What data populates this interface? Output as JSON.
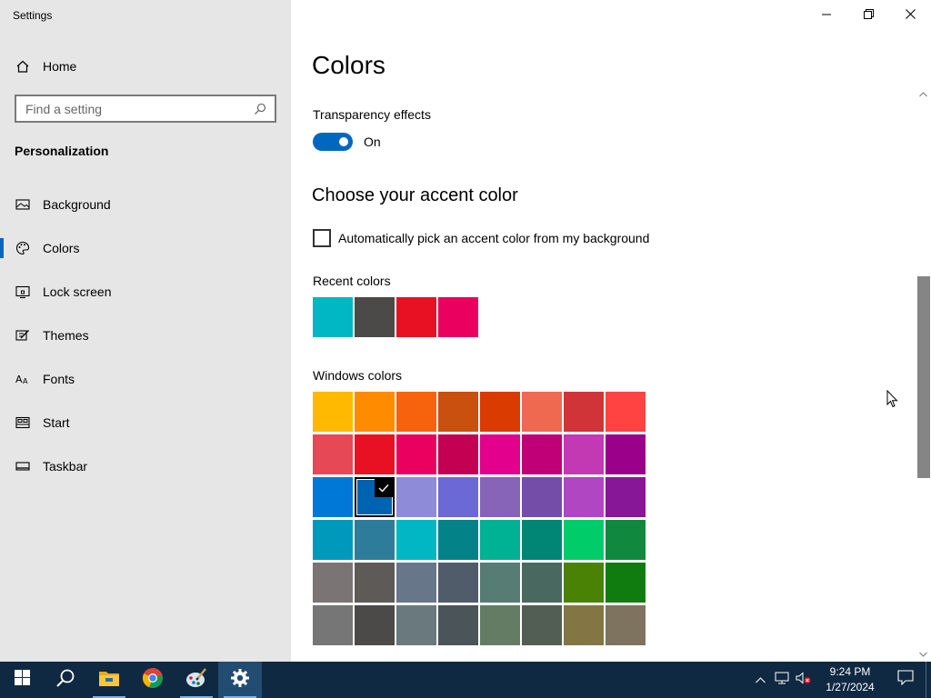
{
  "window": {
    "title": "Settings"
  },
  "sidebar": {
    "home_label": "Home",
    "search_placeholder": "Find a setting",
    "section_title": "Personalization",
    "items": [
      {
        "label": "Background",
        "icon": "image-icon"
      },
      {
        "label": "Colors",
        "icon": "palette-icon",
        "active": true
      },
      {
        "label": "Lock screen",
        "icon": "lock-screen-icon"
      },
      {
        "label": "Themes",
        "icon": "brush-icon"
      },
      {
        "label": "Fonts",
        "icon": "font-icon"
      },
      {
        "label": "Start",
        "icon": "start-icon"
      },
      {
        "label": "Taskbar",
        "icon": "taskbar-icon"
      }
    ]
  },
  "main": {
    "title": "Colors",
    "transparency_label": "Transparency effects",
    "transparency_state": "On",
    "accent_heading": "Choose your accent color",
    "auto_pick_label": "Automatically pick an accent color from my background",
    "recent_label": "Recent colors",
    "recent_colors": [
      "#00b7c3",
      "#4c4a48",
      "#e81123",
      "#ea005e"
    ],
    "windows_label": "Windows colors",
    "windows_colors": [
      [
        "#ffb900",
        "#ff8c00",
        "#f7630c",
        "#ca5010",
        "#da3b01",
        "#ef6950",
        "#d13438",
        "#ff4343"
      ],
      [
        "#e74856",
        "#e81123",
        "#ea005e",
        "#c30052",
        "#e3008c",
        "#bf0077",
        "#c239b3",
        "#9a0089"
      ],
      [
        "#0078d7",
        "#0063b1",
        "#8e8cd8",
        "#6b69d6",
        "#8764b8",
        "#744da9",
        "#b146c2",
        "#881798"
      ],
      [
        "#0099bc",
        "#2d7d9a",
        "#00b7c3",
        "#038387",
        "#00b294",
        "#018574",
        "#00cc6a",
        "#10893e"
      ],
      [
        "#7a7574",
        "#5d5a58",
        "#68768a",
        "#515c6b",
        "#567c73",
        "#486860",
        "#498205",
        "#107c10"
      ],
      [
        "#767676",
        "#4c4a48",
        "#69797e",
        "#4a5459",
        "#647c64",
        "#525e54",
        "#847545",
        "#7e735f"
      ]
    ],
    "selected_color": "#0063b1",
    "accent_color": "#0067c0"
  },
  "taskbar": {
    "apps": [
      "start-icon",
      "search-icon",
      "file-explorer-icon",
      "chrome-icon",
      "paint-icon",
      "settings-icon"
    ],
    "time": "9:24 PM",
    "date": "1/27/2024"
  }
}
